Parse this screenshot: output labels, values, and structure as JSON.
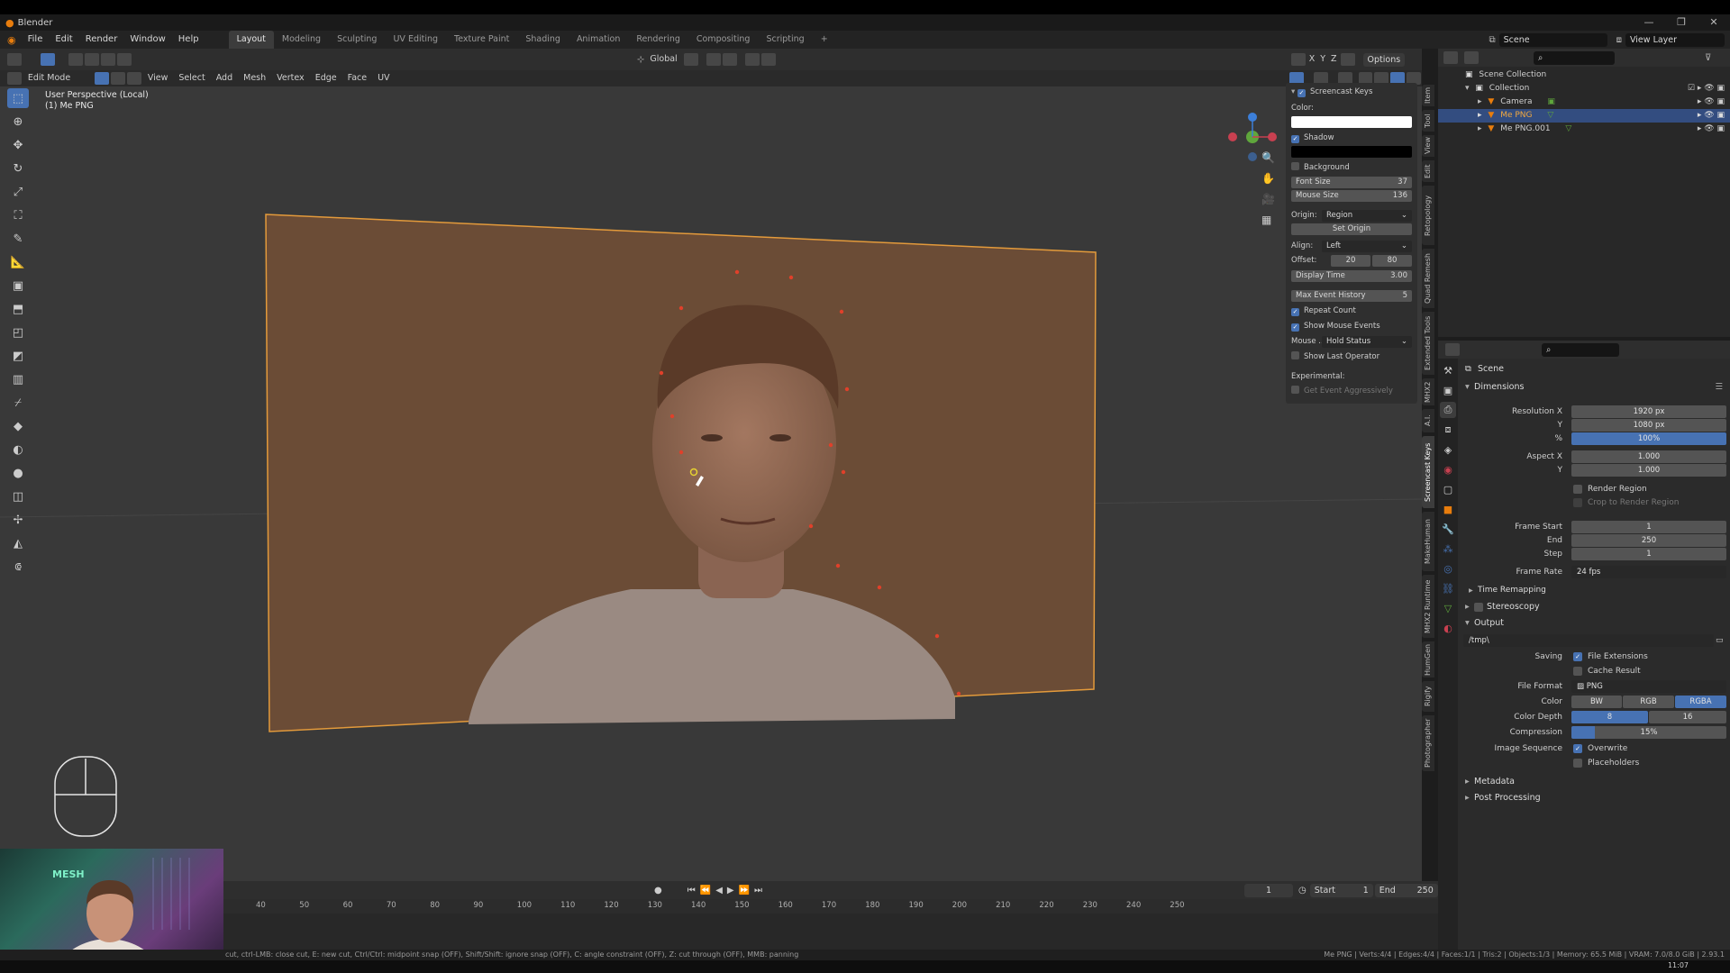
{
  "window": {
    "app_name": "Blender",
    "controls": [
      "—",
      "❐",
      "✕"
    ]
  },
  "menubar": {
    "menus": [
      "File",
      "Edit",
      "Render",
      "Window",
      "Help"
    ],
    "workspaces": [
      "Layout",
      "Modeling",
      "Sculpting",
      "UV Editing",
      "Texture Paint",
      "Shading",
      "Animation",
      "Rendering",
      "Compositing",
      "Scripting"
    ],
    "active_workspace": "Layout",
    "add_workspace": "+",
    "scene": "Scene",
    "view_layer": "View Layer"
  },
  "viewport": {
    "mode": "Edit Mode",
    "header_menus": [
      "View",
      "Select",
      "Add",
      "Mesh",
      "Vertex",
      "Edge",
      "Face",
      "UV"
    ],
    "transform_orientation": "Global",
    "options": "Options",
    "axes": [
      "X",
      "Y",
      "Z"
    ],
    "view_label": "User Perspective (Local)",
    "object_label": "(1) Me PNG",
    "colors": {
      "background": "#393939",
      "plane": "#6b4c36",
      "vertex": "#e0402a",
      "accent": "#4772b3"
    }
  },
  "npanel": {
    "title": "Screencast Keys",
    "color_label": "Color:",
    "shadow": "Shadow",
    "background": "Background",
    "font_size_label": "Font Size",
    "font_size": "37",
    "mouse_size_label": "Mouse Size",
    "mouse_size": "136",
    "origin_label": "Origin:",
    "origin": "Region",
    "set_origin": "Set Origin",
    "align_label": "Align:",
    "align": "Left",
    "offset_label": "Offset:",
    "offset_x": "20",
    "offset_y": "80",
    "display_time_label": "Display Time",
    "display_time": "3.00",
    "max_event_label": "Max Event History",
    "max_event": "5",
    "repeat_count": "Repeat Count",
    "show_mouse_events": "Show Mouse Events",
    "mouse_label": "Mouse ...",
    "mouse_value": "Hold Status",
    "show_last_operator": "Show Last Operator",
    "experimental_label": "Experimental:",
    "get_event": "Get Event Aggressively"
  },
  "side_tabs": [
    "Item",
    "Tool",
    "View",
    "Edit",
    "Retopology",
    "Quad Remesh",
    "Extended Tools",
    "MHX2",
    "A.I.",
    "Screencast Keys",
    "MakeHuman",
    "MHX2 Runtime",
    "HumGen",
    "Rigify",
    "Photographer"
  ],
  "active_side_tab": "Screencast Keys",
  "outliner": {
    "root": "Scene Collection",
    "items": [
      {
        "name": "Collection",
        "indent": 1,
        "selected": false
      },
      {
        "name": "Camera",
        "indent": 2,
        "selected": false
      },
      {
        "name": "Me PNG",
        "indent": 2,
        "selected": true
      },
      {
        "name": "Me PNG.001",
        "indent": 2,
        "selected": false
      }
    ]
  },
  "properties": {
    "context": "Scene",
    "dimensions": "Dimensions",
    "resolution_x_label": "Resolution X",
    "resolution_x": "1920 px",
    "y_label": "Y",
    "resolution_y": "1080 px",
    "percent_label": "%",
    "percent": "100%",
    "aspect_x_label": "Aspect X",
    "aspect_x": "1.000",
    "aspect_y": "1.000",
    "render_region": "Render Region",
    "crop": "Crop to Render Region",
    "frame_start_label": "Frame Start",
    "frame_start": "1",
    "end_label": "End",
    "frame_end": "250",
    "step_label": "Step",
    "step": "1",
    "frame_rate_label": "Frame Rate",
    "frame_rate": "24 fps",
    "time_remapping": "Time Remapping",
    "stereoscopy": "Stereoscopy",
    "output": "Output",
    "path": "/tmp\\",
    "saving_label": "Saving",
    "file_extensions": "File Extensions",
    "cache_result": "Cache Result",
    "file_format_label": "File Format",
    "file_format": "PNG",
    "color_label": "Color",
    "color_modes": [
      "BW",
      "RGB",
      "RGBA"
    ],
    "color_depth_label": "Color Depth",
    "color_depths": [
      "8",
      "16"
    ],
    "compression_label": "Compression",
    "compression": "15%",
    "compression_fraction": 0.15,
    "image_sequence_label": "Image Sequence",
    "overwrite": "Overwrite",
    "placeholders": "Placeholders",
    "metadata": "Metadata",
    "post_processing": "Post Processing"
  },
  "timeline": {
    "current_frame": "1",
    "start_label": "Start",
    "start": "1",
    "end_label": "End",
    "end": "250",
    "ticks": [
      "40",
      "50",
      "60",
      "70",
      "80",
      "90",
      "100",
      "110",
      "120",
      "130",
      "140",
      "150",
      "160",
      "170",
      "180",
      "190",
      "200",
      "210",
      "220",
      "230",
      "240",
      "250"
    ]
  },
  "statusbar": {
    "left": "cut, ctrl-LMB: close cut, E: new cut, Ctrl/Ctrl: midpoint snap (OFF), Shift/Shift: ignore snap (OFF), C: angle constraint (OFF), Z: cut through (OFF), MMB: panning",
    "right": "Me PNG | Verts:4/4 | Edges:4/4 | Faces:1/1 | Tris:2 | Objects:1/3 | Memory: 65.5 MiB | VRAM: 7.0/8.0 GiB | 2.93.1",
    "clock": "11:07"
  },
  "webcam": {
    "logo": "MESH"
  }
}
